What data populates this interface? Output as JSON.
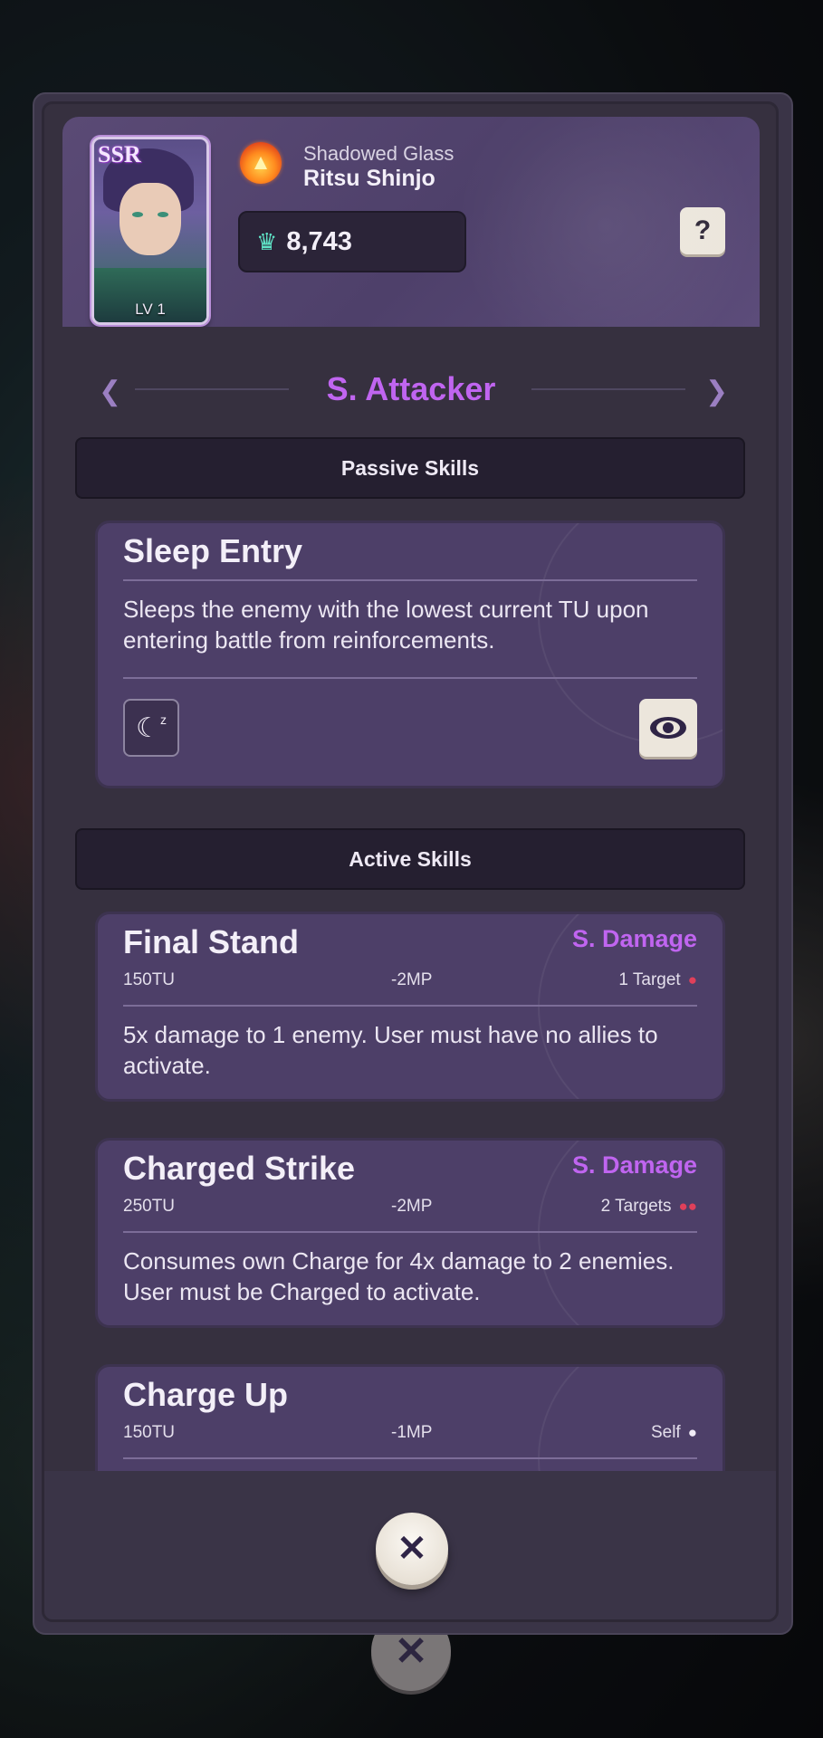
{
  "character": {
    "rarity": "SSR",
    "level": "LV 1",
    "subtitle": "Shadowed Glass",
    "name": "Ritsu Shinjo",
    "power": "8,743",
    "element_icon": "fire-element-icon"
  },
  "help_label": "?",
  "role": "S. Attacker",
  "passive_section": "Passive Skills",
  "active_section": "Active Skills",
  "passive_skills": [
    {
      "name": "Sleep Entry",
      "description": "Sleeps the enemy with the lowest current TU upon entering battle from reinforcements.",
      "status_icon": "sleep-moon-icon",
      "view_icon": "eye-icon"
    }
  ],
  "active_skills": [
    {
      "name": "Final Stand",
      "type": "S. Damage",
      "tu": "150TU",
      "mp": "-2MP",
      "target": "1 Target",
      "description": "5x damage to 1 enemy. User must have no allies to activate."
    },
    {
      "name": "Charged Strike",
      "type": "S. Damage",
      "tu": "250TU",
      "mp": "-2MP",
      "target": "2 Targets",
      "description": "Consumes own Charge for 4x damage to 2 enemies. User must be Charged to activate."
    },
    {
      "name": "Charge Up",
      "type": "",
      "tu": "150TU",
      "mp": "-1MP",
      "target": "Self",
      "description": ""
    }
  ],
  "colors": {
    "accent_purple": "#c065f0",
    "target_red": "#e0405a",
    "power_teal": "#5fe3c6"
  }
}
